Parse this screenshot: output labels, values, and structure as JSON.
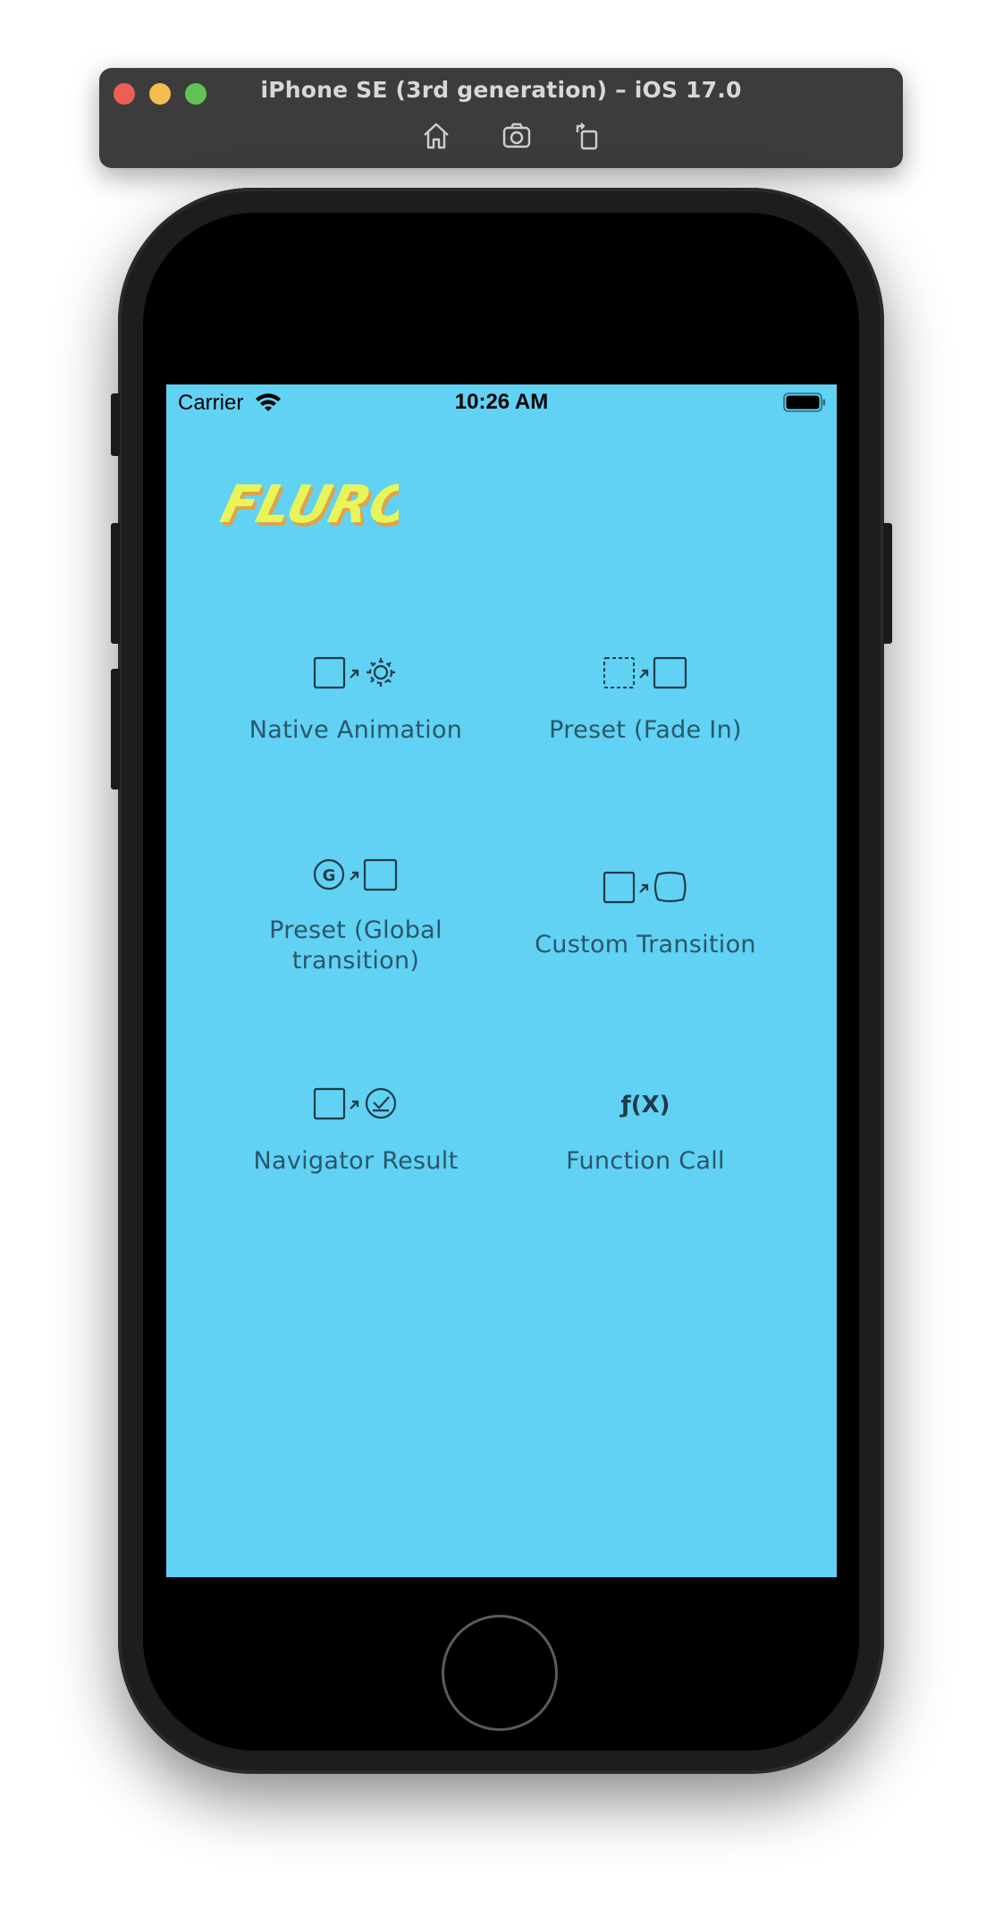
{
  "window": {
    "title": "iPhone SE (3rd generation) – iOS 17.0",
    "toolbar": {
      "home_icon": "home-icon",
      "screenshot_icon": "camera-icon",
      "rotate_icon": "rotate-icon"
    }
  },
  "status_bar": {
    "carrier": "Carrier",
    "time": "10:26 AM"
  },
  "app": {
    "logo_text": "FLURO",
    "background_color": "#61d2f3",
    "logo_color": "#e8f55a",
    "label_color": "#2a566b",
    "tiles": [
      {
        "label": "Native Animation",
        "icon": "native-animation-icon"
      },
      {
        "label": "Preset (Fade In)",
        "icon": "fade-in-icon"
      },
      {
        "label": "Preset (Global transition)",
        "icon": "global-transition-icon"
      },
      {
        "label": "Custom Transition",
        "icon": "custom-transition-icon"
      },
      {
        "label": "Navigator Result",
        "icon": "navigator-result-icon"
      },
      {
        "label": "Function Call",
        "icon": "function-call-icon"
      }
    ]
  }
}
